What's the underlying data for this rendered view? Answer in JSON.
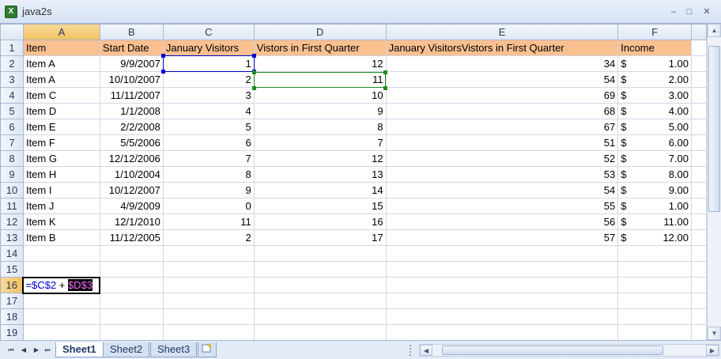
{
  "window": {
    "title": "java2s",
    "app_icon_letter": "X",
    "minimize": "–",
    "maximize": "□",
    "close": "✕"
  },
  "columns": [
    "A",
    "B",
    "C",
    "D",
    "E",
    "F"
  ],
  "header_row": {
    "row_no": "1",
    "item": "Item",
    "start_date": "Start Date",
    "jan_visitors": "January Visitors",
    "q1_visitors": "Vistors in First Quarter",
    "combined": "January VisitorsVistors in First Quarter",
    "income": "Income"
  },
  "rows": [
    {
      "n": "2",
      "item": "Item A",
      "date": "9/9/2007",
      "jan": "1",
      "q1": "12",
      "e": "34",
      "cur": "$",
      "inc": "1.00"
    },
    {
      "n": "3",
      "item": "Item A",
      "date": "10/10/2007",
      "jan": "2",
      "q1": "11",
      "e": "54",
      "cur": "$",
      "inc": "2.00"
    },
    {
      "n": "4",
      "item": "Item C",
      "date": "11/11/2007",
      "jan": "3",
      "q1": "10",
      "e": "69",
      "cur": "$",
      "inc": "3.00"
    },
    {
      "n": "5",
      "item": "Item D",
      "date": "1/1/2008",
      "jan": "4",
      "q1": "9",
      "e": "68",
      "cur": "$",
      "inc": "4.00"
    },
    {
      "n": "6",
      "item": "Item E",
      "date": "2/2/2008",
      "jan": "5",
      "q1": "8",
      "e": "67",
      "cur": "$",
      "inc": "5.00"
    },
    {
      "n": "7",
      "item": "Item F",
      "date": "5/5/2006",
      "jan": "6",
      "q1": "7",
      "e": "51",
      "cur": "$",
      "inc": "6.00"
    },
    {
      "n": "8",
      "item": "Item G",
      "date": "12/12/2006",
      "jan": "7",
      "q1": "12",
      "e": "52",
      "cur": "$",
      "inc": "7.00"
    },
    {
      "n": "9",
      "item": "Item H",
      "date": "1/10/2004",
      "jan": "8",
      "q1": "13",
      "e": "53",
      "cur": "$",
      "inc": "8.00"
    },
    {
      "n": "10",
      "item": "Item I",
      "date": "10/12/2007",
      "jan": "9",
      "q1": "14",
      "e": "54",
      "cur": "$",
      "inc": "9.00"
    },
    {
      "n": "11",
      "item": "Item J",
      "date": "4/9/2009",
      "jan": "0",
      "q1": "15",
      "e": "55",
      "cur": "$",
      "inc": "1.00"
    },
    {
      "n": "12",
      "item": "Item K",
      "date": "12/1/2010",
      "jan": "11",
      "q1": "16",
      "e": "56",
      "cur": "$",
      "inc": "11.00"
    },
    {
      "n": "13",
      "item": "Item B",
      "date": "11/12/2005",
      "jan": "2",
      "q1": "17",
      "e": "57",
      "cur": "$",
      "inc": "12.00"
    }
  ],
  "empty_rows": [
    "14",
    "15",
    "16",
    "17",
    "18",
    "19"
  ],
  "edit_cell": {
    "row": "16",
    "ref1": "=$C$2",
    "plus": " + ",
    "ref2": "$D$3"
  },
  "sheet_tabs": [
    "Sheet1",
    "Sheet2",
    "Sheet3"
  ],
  "nav_buttons": [
    "⏮",
    "◀",
    "▶",
    "⏭"
  ],
  "scroll": {
    "up": "▲",
    "down": "▼",
    "left": "◀",
    "right": "▶"
  },
  "colors": {
    "header_fill": "#fac090",
    "ref_blue": "#0000cc",
    "ref_green": "#228b22"
  }
}
